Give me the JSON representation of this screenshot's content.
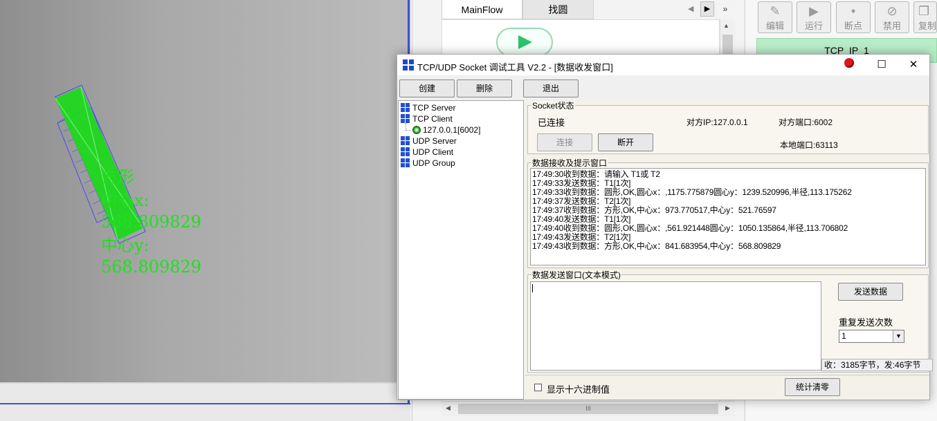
{
  "camera": {
    "overlay_lines": [
      "方形",
      "中心x:",
      "568.809829",
      "中心y:",
      "568.809829"
    ]
  },
  "flow": {
    "tabs": [
      "MainFlow",
      "找圆"
    ],
    "play_icon": "play-icon",
    "hscroll_thumb_label": "III"
  },
  "toolbar": {
    "buttons": [
      {
        "label": "编辑",
        "icon": "edit-icon"
      },
      {
        "label": "运行",
        "icon": "play-icon"
      },
      {
        "label": "断点",
        "icon": "breakpoint-icon"
      },
      {
        "label": "禁用",
        "icon": "disable-icon"
      },
      {
        "label": "复制",
        "icon": "copy-icon"
      }
    ],
    "node_label": "TCP_IP_1"
  },
  "dialog": {
    "title": "TCP/UDP Socket 调试工具 V2.2 - [数据收发窗口]",
    "buttons": {
      "create": "创建",
      "delete": "删除",
      "exit": "退出"
    },
    "tree": [
      {
        "label": "TCP Server"
      },
      {
        "label": "TCP Client"
      },
      {
        "label": "127.0.0.1[6002]"
      },
      {
        "label": "UDP Server"
      },
      {
        "label": "UDP Client"
      },
      {
        "label": "UDP Group"
      }
    ],
    "socket_status": {
      "title": "Socket状态",
      "state": "已连接",
      "remote_ip": "对方IP:127.0.0.1",
      "remote_port": "对方端口:6002",
      "local_port": "本地端口:63113",
      "connect_label": "连接",
      "disconnect_label": "断开"
    },
    "receive": {
      "title": "数据接收及提示窗口",
      "lines": [
        "17:49:30收到数据：请输入 T1或 T2",
        "17:49:33发送数据：T1[1次]",
        "17:49:33收到数据：圆形,OK,圆心x：,1175.775879圆心y：1239.520996,半径,113.175262",
        "17:49:37发送数据：T2[1次]",
        "17:49:37收到数据：方形,OK,中心x：973.770517,中心y：521.76597",
        "17:49:40发送数据：T1[1次]",
        "17:49:40收到数据：圆形,OK,圆心x：,561.921448圆心y：1050.135864,半径,113.706802",
        "17:49:43发送数据：T2[1次]",
        "17:49:43收到数据：方形,OK,中心x：841.683954,中心y：568.809829"
      ]
    },
    "send": {
      "title": "数据发送窗口(文本模式)",
      "send_button": "发送数据",
      "repeat_label": "重复发送次数",
      "repeat_value": "1",
      "stats": "收：3185字节，发:46字节",
      "hex_label": "显示十六进制值",
      "reset_label": "统计清零"
    }
  }
}
